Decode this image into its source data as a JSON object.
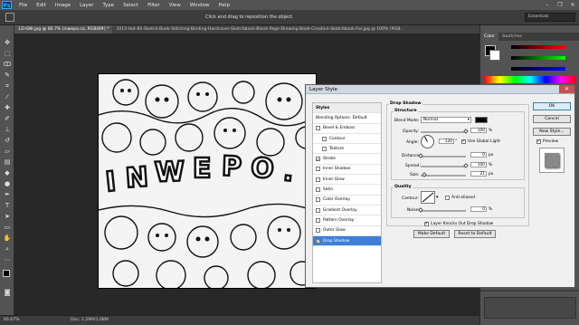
{
  "app": {
    "logo": "Ps"
  },
  "menu": [
    "File",
    "Edit",
    "Image",
    "Layer",
    "Type",
    "Select",
    "Filter",
    "View",
    "Window",
    "Help"
  ],
  "window_controls": {
    "minimize": "–",
    "restore": "❐",
    "close": "✕"
  },
  "options_bar": {
    "hint": "Click and drag to reposition the object.",
    "workspace": "Essentials"
  },
  "tabs": [
    {
      "label": "1ZnSNl.jpg @ 66.7% (inwepo.co, RGB/8#) *",
      "active": true
    },
    {
      "label": "2015-Hot-85-Sketch-Book-Stitching-Binding-Hardcover-Sketchbook-Blank-Page-Drawing-Book-Creative-Sketchbook-For.jpg @ 100% (RGB...",
      "active": false
    }
  ],
  "status": {
    "zoom": "66.67%",
    "doc": "Doc: 1.29M/1.08M"
  },
  "right_panel": {
    "tabs": [
      "Color",
      "Swatches"
    ],
    "active_tab": "Color"
  },
  "dialog": {
    "title": "Layer Style",
    "styles_header": "Styles",
    "styles": [
      {
        "label": "Blending Options: Default",
        "checkbox": false,
        "checked": false,
        "selected": false
      },
      {
        "label": "Bevel & Emboss",
        "checkbox": true,
        "checked": false,
        "selected": false
      },
      {
        "label": "Contour",
        "checkbox": true,
        "checked": false,
        "selected": false,
        "indent": true
      },
      {
        "label": "Texture",
        "checkbox": true,
        "checked": false,
        "selected": false,
        "indent": true
      },
      {
        "label": "Stroke",
        "checkbox": true,
        "checked": true,
        "selected": false
      },
      {
        "label": "Inner Shadow",
        "checkbox": true,
        "checked": false,
        "selected": false
      },
      {
        "label": "Inner Glow",
        "checkbox": true,
        "checked": false,
        "selected": false
      },
      {
        "label": "Satin",
        "checkbox": true,
        "checked": false,
        "selected": false
      },
      {
        "label": "Color Overlay",
        "checkbox": true,
        "checked": false,
        "selected": false
      },
      {
        "label": "Gradient Overlay",
        "checkbox": true,
        "checked": false,
        "selected": false
      },
      {
        "label": "Pattern Overlay",
        "checkbox": true,
        "checked": false,
        "selected": false
      },
      {
        "label": "Outer Glow",
        "checkbox": true,
        "checked": false,
        "selected": false
      },
      {
        "label": "Drop Shadow",
        "checkbox": true,
        "checked": true,
        "selected": true
      }
    ],
    "drop_shadow": {
      "section_title": "Drop Shadow",
      "structure_title": "Structure",
      "blend_mode_label": "Blend Mode:",
      "blend_mode_value": "Normal",
      "shadow_color": "#000000",
      "opacity_label": "Opacity:",
      "opacity_value": "100",
      "opacity_unit": "%",
      "opacity_level": 1.0,
      "angle_label": "Angle:",
      "angle_value": "120",
      "angle_unit": "°",
      "global_light_label": "Use Global Light",
      "global_light_checked": true,
      "distance_label": "Distance:",
      "distance_value": "0",
      "distance_unit": "px",
      "distance_level": 0.0,
      "spread_label": "Spread:",
      "spread_value": "100",
      "spread_unit": "%",
      "spread_level": 1.0,
      "size_label": "Size:",
      "size_value": "21",
      "size_unit": "px",
      "size_level": 0.08,
      "quality_title": "Quality",
      "contour_label": "Contour:",
      "anti_aliased_label": "Anti-aliased",
      "anti_aliased_checked": false,
      "noise_label": "Noise:",
      "noise_value": "0",
      "noise_unit": "%",
      "noise_level": 0.0,
      "knocks_out_label": "Layer Knocks Out Drop Shadow",
      "knocks_out_checked": true,
      "make_default": "Make Default",
      "reset_default": "Reset to Default"
    },
    "buttons": {
      "ok": "OK",
      "cancel": "Cancel",
      "new_style": "New Style...",
      "preview": "Preview"
    },
    "preview_checked": true
  }
}
